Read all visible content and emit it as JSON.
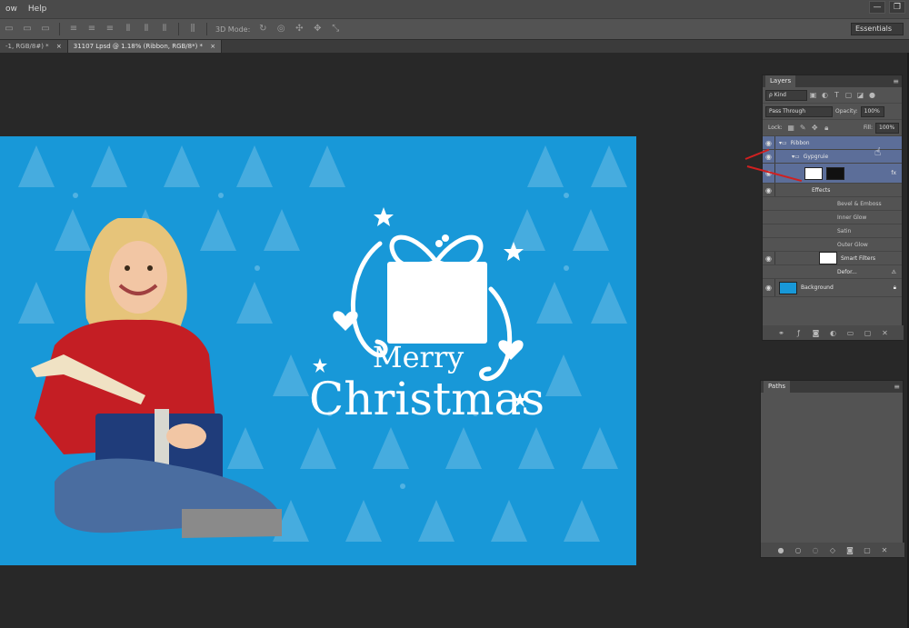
{
  "menubar": {
    "items": [
      "ow",
      "Help"
    ],
    "window_controls": [
      "—",
      "❐"
    ]
  },
  "options_bar": {
    "mode_label": "3D Mode:",
    "workspace": "Essentials"
  },
  "tabs": [
    {
      "label": "-1, RGB/8#) *",
      "close": "×"
    },
    {
      "label": "31107 Lpsd @ 1.18% (Ribbon, RGB/8*) *",
      "close": "×"
    }
  ],
  "document": {
    "background_color": "#1898d8",
    "greeting_line1": "Merry",
    "greeting_line2": "Christmas"
  },
  "layers_panel": {
    "tab_label": "Layers",
    "filter_kind": "ρ Kind",
    "blend_mode": "Pass Through",
    "opacity_label": "Opacity:",
    "opacity_value": "100%",
    "lock_label": "Lock:",
    "fill_label": "Fill:",
    "fill_value": "100%",
    "layers": [
      {
        "name": "Ribbon"
      },
      {
        "name": "Gypgruie"
      },
      {
        "name": "Effects"
      },
      {
        "name": "Bevel & Emboss"
      },
      {
        "name": "Inner Glow"
      },
      {
        "name": "Satin"
      },
      {
        "name": "Outer Glow"
      },
      {
        "name": "Smart Filters"
      },
      {
        "name": "Defor..."
      },
      {
        "name": "Background"
      }
    ]
  },
  "paths_panel": {
    "tab_label": "Paths"
  }
}
